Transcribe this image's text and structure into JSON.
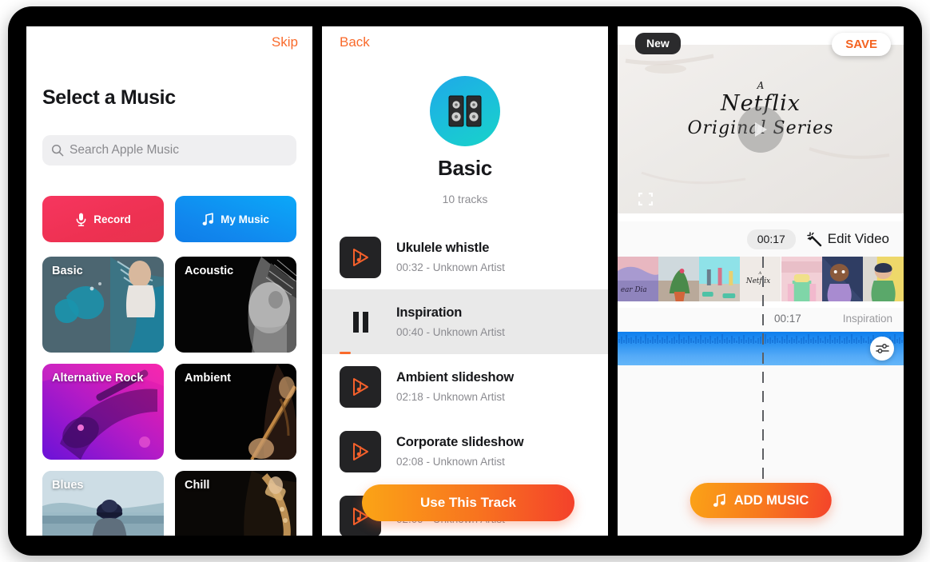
{
  "panel1": {
    "skip_label": "Skip",
    "title": "Select a Music",
    "search": {
      "placeholder": "Search Apple Music",
      "icon": "search-icon"
    },
    "actions": [
      {
        "label": "Record",
        "icon": "microphone-icon",
        "color": "#EE3152"
      },
      {
        "label": "My Music",
        "icon": "music-note-icon",
        "color": "#1187EE"
      }
    ],
    "categories": [
      {
        "label": "Basic"
      },
      {
        "label": "Acoustic"
      },
      {
        "label": "Alternative Rock"
      },
      {
        "label": "Ambient"
      },
      {
        "label": "Blues"
      },
      {
        "label": "Chill"
      }
    ]
  },
  "panel2": {
    "back_label": "Back",
    "album_title": "Basic",
    "album_subtitle": "10 tracks",
    "album_art_icon": "speakers-icon",
    "tracks": [
      {
        "name": "Ukulele whistle",
        "meta": "00:32 - Unknown Artist",
        "state": "paused",
        "icon": "play-music-icon"
      },
      {
        "name": "Inspiration",
        "meta": "00:40 - Unknown Artist",
        "state": "playing",
        "icon": "pause-icon"
      },
      {
        "name": "Ambient slideshow",
        "meta": "02:18 - Unknown Artist",
        "state": "paused",
        "icon": "play-music-icon"
      },
      {
        "name": "Corporate slideshow",
        "meta": "02:08 - Unknown Artist",
        "state": "paused",
        "icon": "play-music-icon"
      },
      {
        "name": "",
        "meta": "02:09 - Unknown Artist",
        "state": "paused",
        "icon": "play-music-icon"
      }
    ],
    "use_track_label": "Use This Track"
  },
  "panel3": {
    "new_badge": "New",
    "save_label": "SAVE",
    "video": {
      "line1": "A",
      "line2": "Netflix",
      "line3": "Original Series",
      "play_icon": "play-icon",
      "fullscreen_icon": "fullscreen-icon"
    },
    "timeline": {
      "current_time": "00:17",
      "edit_label": "Edit Video",
      "edit_icon": "magic-wand-icon",
      "track_time": "00:17",
      "track_name": "Inspiration",
      "equalizer_icon": "sliders-icon"
    },
    "add_music_label": "ADD MUSIC",
    "add_music_icon": "music-note-icon"
  },
  "colors": {
    "accent_orange": "#F96A2B",
    "gradient_start": "#FBA416",
    "gradient_end": "#F4412B",
    "waveform_blue": "#2E94F2"
  }
}
